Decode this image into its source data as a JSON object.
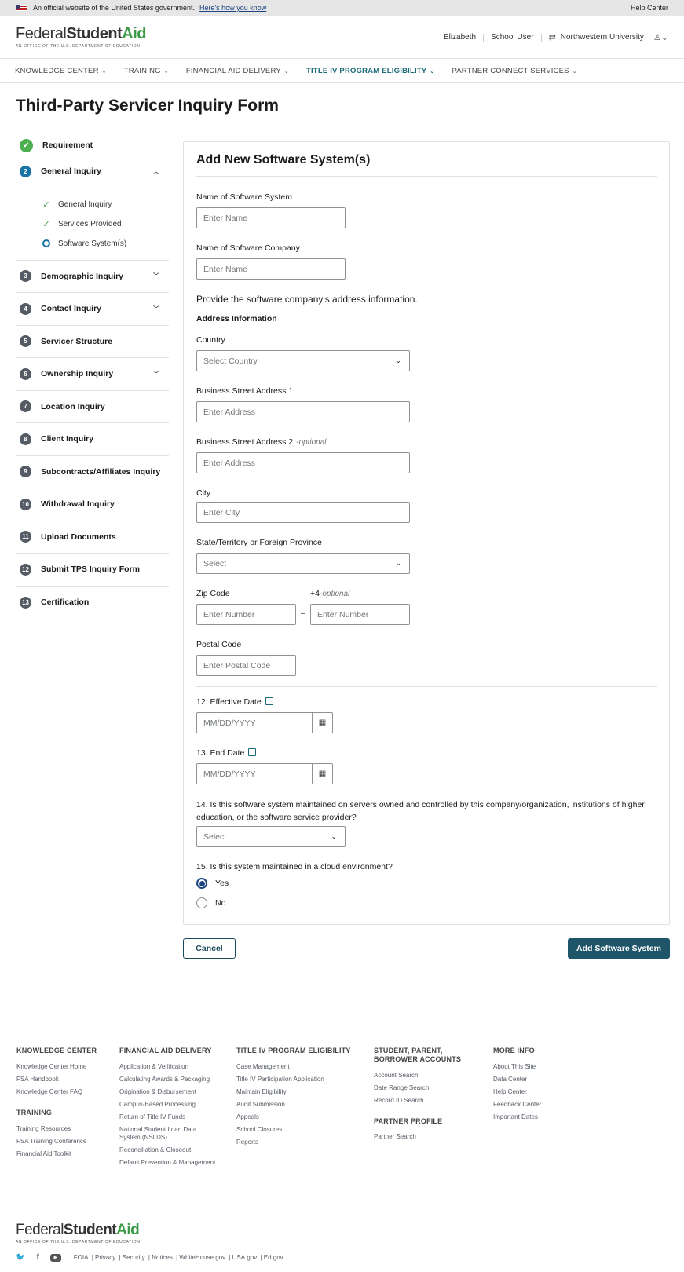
{
  "banner": {
    "text": "An official website of the United States government.",
    "link": "Here's how you know",
    "help": "Help Center"
  },
  "header": {
    "logo_prefix": "Federal",
    "logo_mid": "Student",
    "logo_suffix": "Aid",
    "logo_sub": "AN OFFICE OF THE U.S. DEPARTMENT OF EDUCATION",
    "user": "Elizabeth",
    "role": "School User",
    "school": "Northwestern University"
  },
  "nav": [
    {
      "label": "KNOWLEDGE CENTER"
    },
    {
      "label": "TRAINING"
    },
    {
      "label": "FINANCIAL AID DELIVERY"
    },
    {
      "label": "TITLE IV PROGRAM ELIGIBILITY"
    },
    {
      "label": "PARTNER CONNECT SERVICES"
    }
  ],
  "page_title": "Third-Party Servicer Inquiry Form",
  "steps": {
    "requirement": "Requirement",
    "general": {
      "num": "2",
      "label": "General Inquiry"
    },
    "substeps": [
      "General Inquiry",
      "Services Provided",
      "Software System(s)"
    ],
    "rest": [
      {
        "num": "3",
        "label": "Demographic Inquiry"
      },
      {
        "num": "4",
        "label": "Contact Inquiry"
      },
      {
        "num": "5",
        "label": "Servicer Structure"
      },
      {
        "num": "6",
        "label": "Ownership Inquiry"
      },
      {
        "num": "7",
        "label": "Location Inquiry"
      },
      {
        "num": "8",
        "label": "Client Inquiry"
      },
      {
        "num": "9",
        "label": "Subcontracts/Affiliates Inquiry"
      },
      {
        "num": "10",
        "label": "Withdrawal Inquiry"
      },
      {
        "num": "11",
        "label": "Upload Documents"
      },
      {
        "num": "12",
        "label": "Submit TPS Inquiry Form"
      },
      {
        "num": "13",
        "label": "Certification"
      }
    ]
  },
  "form": {
    "title": "Add New Software System(s)",
    "software_name_label": "Name of Software System",
    "software_name_ph": "Enter Name",
    "company_name_label": "Name of Software Company",
    "company_name_ph": "Enter Name",
    "address_intro": "Provide the software company's address information.",
    "address_heading": "Address Information",
    "country_label": "Country",
    "country_value": "Select Country",
    "street1_label": "Business Street Address 1",
    "street1_ph": "Enter Address",
    "street2_label": "Business Street Address 2",
    "street2_opt": "-optional",
    "street2_ph": "Enter Address",
    "city_label": "City",
    "city_ph": "Enter City",
    "state_label": "State/Territory or Foreign Province",
    "state_value": "Select",
    "zip_label": "Zip Code",
    "zip_ph": "Enter Number",
    "zip4_label": "+4",
    "zip4_opt": "-optional",
    "zip4_ph": "Enter Number",
    "zip_dash": "–",
    "postal_label": "Postal Code",
    "postal_ph": "Enter Postal Code",
    "eff_date_label": "12. Effective Date",
    "eff_date_ph": "MM/DD/YYYY",
    "end_date_label": "13. End Date",
    "end_date_ph": "MM/DD/YYYY",
    "q14": "14. Is this software system maintained on servers owned and controlled by this company/organization, institutions of higher education, or the software service provider?",
    "q14_value": "Select",
    "q15": "15. Is this system maintained in a cloud environment?",
    "q15_yes": "Yes",
    "q15_no": "No",
    "q15_selected": "Yes"
  },
  "buttons": {
    "cancel": "Cancel",
    "add": "Add Software System"
  },
  "footer": {
    "knowledge": {
      "title": "KNOWLEDGE CENTER",
      "links": [
        "Knowledge Center Home",
        "FSA Handbook",
        "Knowledge Center FAQ"
      ]
    },
    "training": {
      "title": "TRAINING",
      "links": [
        "Training Resources",
        "FSA Training Conference",
        "Financial Aid Toolkit"
      ]
    },
    "fad": {
      "title": "FINANCIAL AID DELIVERY",
      "links": [
        "Application & Verification",
        "Calculating Awards & Packaging",
        "Origination & Disbursement",
        "Campus-Based Processing",
        "Return of Title IV Funds",
        "National Student Loan Data System (NSLDS)",
        "Reconciliation & Closeout",
        "Default Prevention & Management"
      ]
    },
    "t4": {
      "title": "TITLE IV PROGRAM ELIGIBILITY",
      "links": [
        "Case Management",
        "Title IV Participation Application",
        "Maintain Eligibility",
        "Audit Submission",
        "Appeals",
        "School Closures",
        "Reports"
      ]
    },
    "spb": {
      "title": "STUDENT, PARENT, BORROWER ACCOUNTS",
      "links": [
        "Account Search",
        "Date Range Search",
        "Record ID Search"
      ]
    },
    "partner": {
      "title": "PARTNER PROFILE",
      "links": [
        "Partner Search"
      ]
    },
    "more": {
      "title": "MORE INFO",
      "links": [
        "About This Site",
        "Data Center",
        "Help Center",
        "Feedback Center",
        "Important Dates"
      ]
    },
    "legal": [
      "FOIA",
      "Privacy",
      "Security",
      "Notices",
      "WhiteHouse.gov",
      "USA.gov",
      "Ed.gov"
    ]
  }
}
